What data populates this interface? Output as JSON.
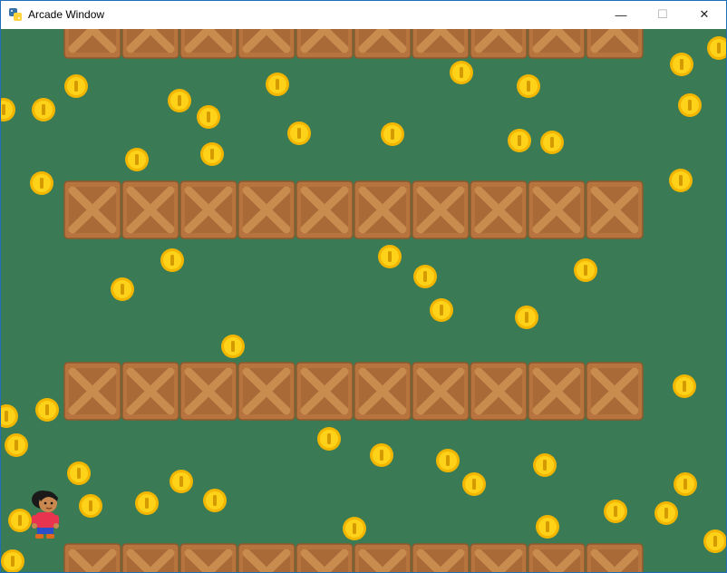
{
  "window": {
    "title": "Arcade Window",
    "controls": {
      "minimize": "—",
      "maximize": "☐",
      "close": "✕"
    }
  },
  "game": {
    "background_color": "#3a7a55",
    "crate_colors": {
      "fill": "#b7743e",
      "light": "#c98c4f",
      "dark": "#8e5a2d"
    },
    "coin_colors": {
      "outer": "#f2b600",
      "inner": "#ffd21a",
      "slot": "#d59a00"
    },
    "player": {
      "name": "female-adventurer"
    }
  }
}
